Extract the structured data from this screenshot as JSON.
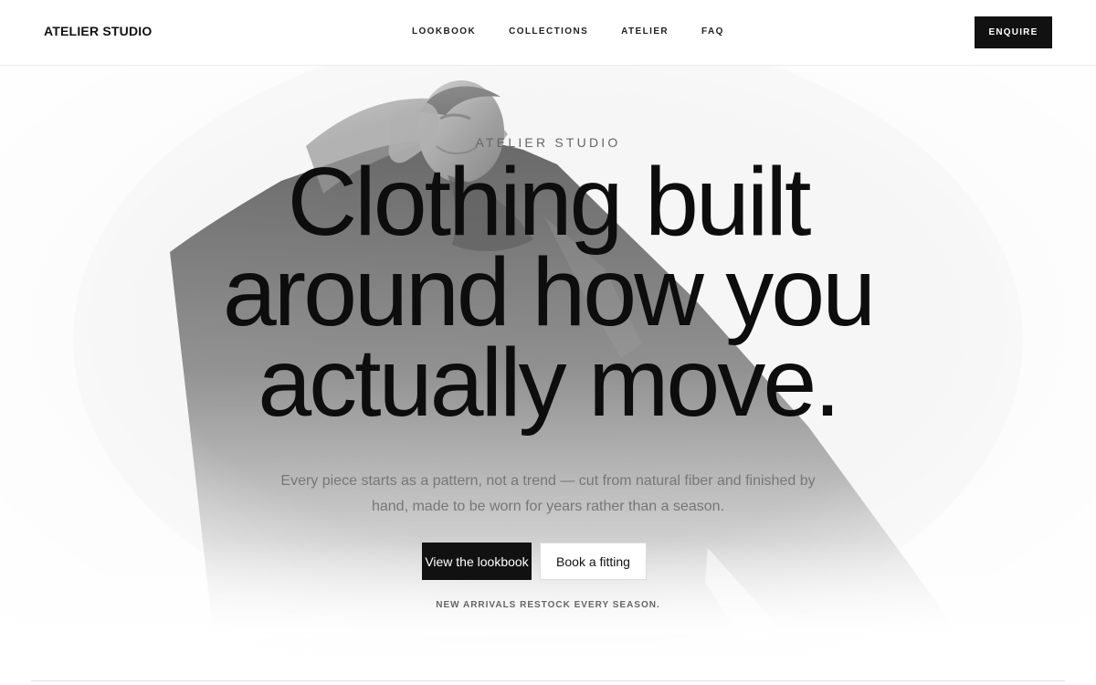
{
  "header": {
    "brand": "ATELIER STUDIO",
    "nav": {
      "lookbook": "LOOKBOOK",
      "collections": "COLLECTIONS",
      "atelier": "ATELIER",
      "faq": "FAQ"
    },
    "enquire_label": "ENQUIRE"
  },
  "hero": {
    "eyebrow": "ATELIER STUDIO",
    "headline": {
      "line1": "Clothing built",
      "line2": "around how you",
      "line3": "actually move."
    },
    "subcopy": "Every piece starts as a pattern, not a trend — cut from natural fiber and finished by hand, made to be worn for years rather than a season.",
    "primary_cta": "View the lookbook",
    "secondary_cta": "Book a fitting",
    "note": "NEW ARRIVALS RESTOCK EVERY SEASON."
  },
  "colors": {
    "accent": "#111111",
    "text_muted": "#777777",
    "background": "#ffffff"
  }
}
